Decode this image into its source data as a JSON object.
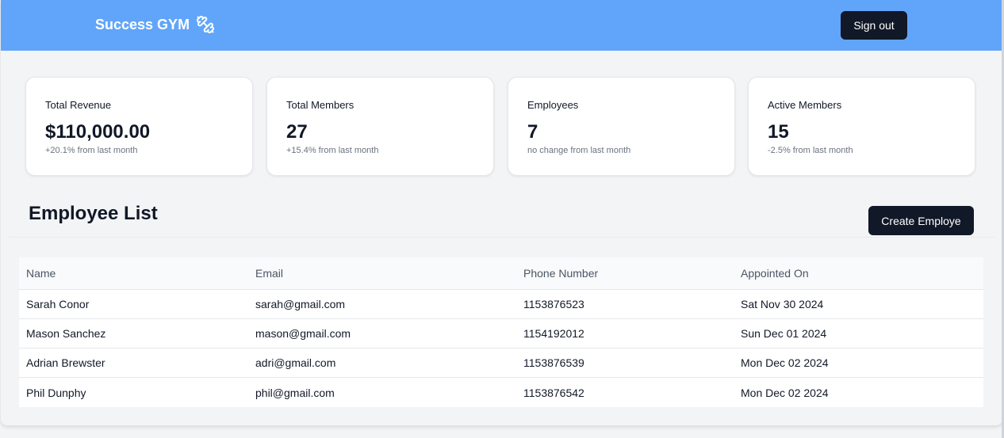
{
  "header": {
    "brand": "Success GYM",
    "brand_icon": "dumbbell-icon",
    "signout_label": "Sign out",
    "color": "#60a5fa"
  },
  "stats": [
    {
      "label": "Total Revenue",
      "value": "$110,000.00",
      "change": "+20.1% from last month"
    },
    {
      "label": "Total Members",
      "value": "27",
      "change": "+15.4% from last month"
    },
    {
      "label": "Employees",
      "value": "7",
      "change": "no change from last month"
    },
    {
      "label": "Active Members",
      "value": "15",
      "change": "-2.5% from last month"
    }
  ],
  "employees": {
    "title": "Employee List",
    "create_label": "Create Employe",
    "columns": [
      "Name",
      "Email",
      "Phone Number",
      "Appointed On"
    ],
    "rows": [
      [
        "Sarah Conor",
        "sarah@gmail.com",
        "1153876523",
        "Sat Nov 30 2024"
      ],
      [
        "Mason Sanchez",
        "mason@gmail.com",
        "1154192012",
        "Sun Dec 01 2024"
      ],
      [
        "Adrian Brewster",
        "adri@gmail.com",
        "1153876539",
        "Mon Dec 02 2024"
      ],
      [
        "Phil Dunphy",
        "phil@gmail.com",
        "1153876542",
        "Mon Dec 02 2024"
      ]
    ]
  }
}
